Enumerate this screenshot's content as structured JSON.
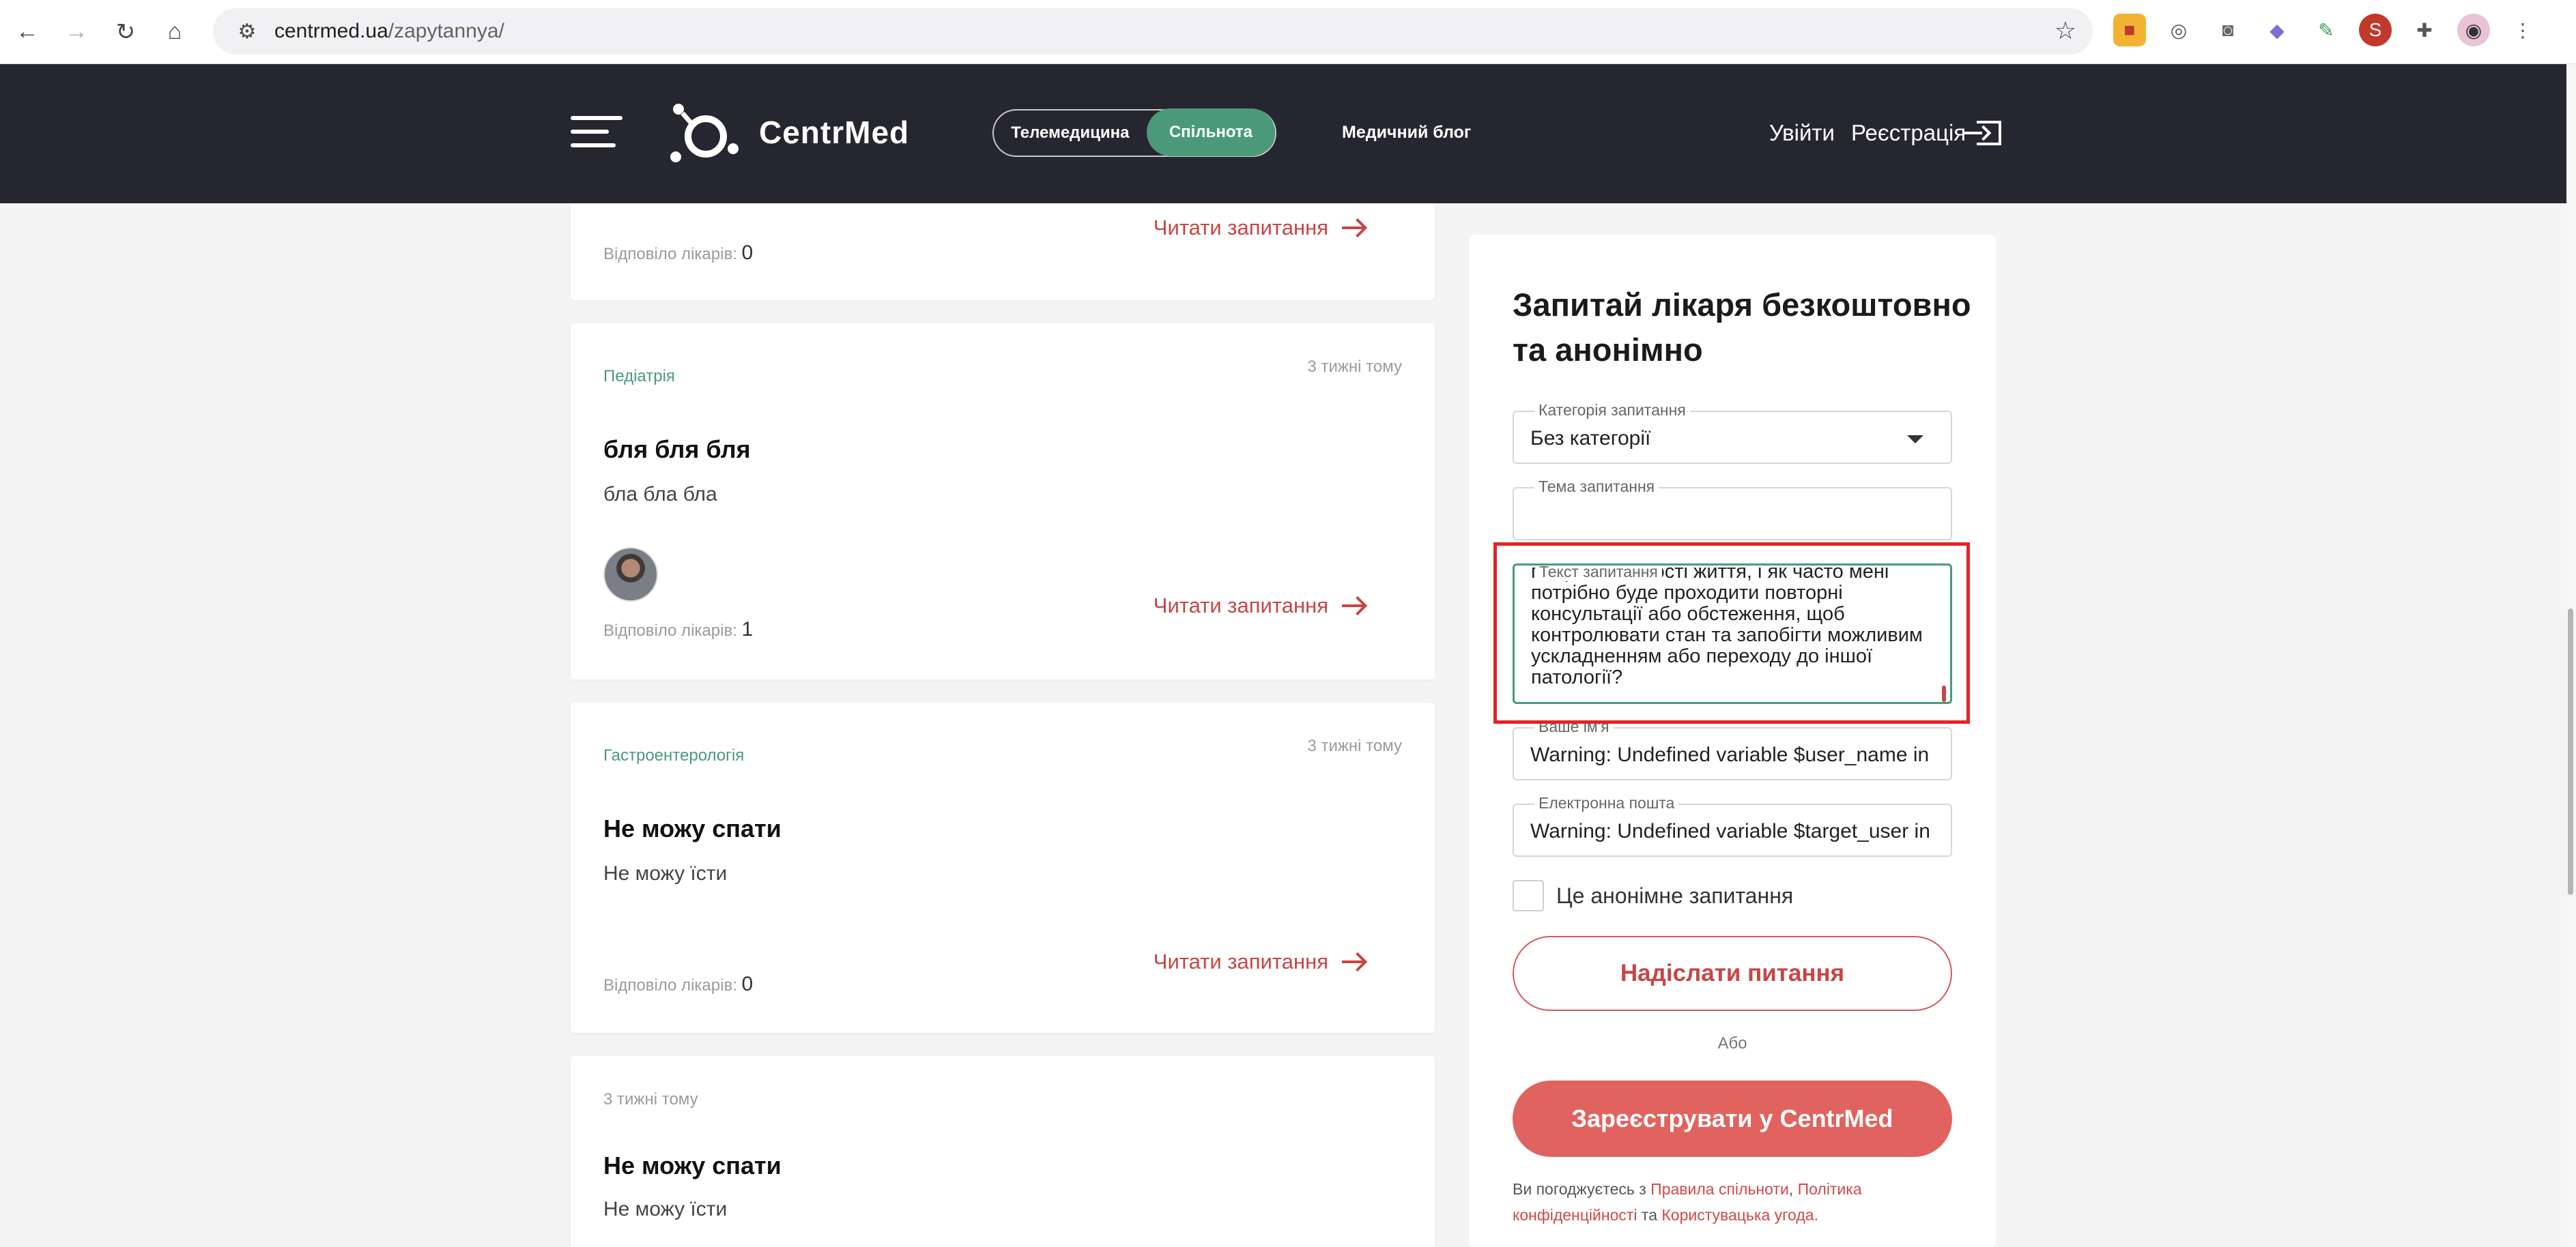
{
  "browser": {
    "url_host": "centrmed.ua",
    "url_path": "/zapytannya/"
  },
  "header": {
    "logo_text": "CentrMed",
    "toggle_telemedicine": "Телемедицина",
    "toggle_community": "Спільнота",
    "blog_link": "Медичний блог",
    "login": "Увійти",
    "register": "Реєстрація"
  },
  "cards": [
    {
      "answered_label": "Відповіло лікарів:",
      "answered_count": "0",
      "read_link": "Читати запитання"
    },
    {
      "category": "Педіатрія",
      "time": "3 тижні тому",
      "title": "бля бля бля",
      "text": "бла бла бла",
      "answered_label": "Відповіло лікарів:",
      "answered_count": "1",
      "read_link": "Читати запитання"
    },
    {
      "category": "Гастроентерологія",
      "time": "3 тижні тому",
      "title": "Не можу спати",
      "text": "Не можу їсти",
      "answered_label": "Відповіло лікарів:",
      "answered_count": "0",
      "read_link": "Читати запитання"
    },
    {
      "time": "3 тижні тому",
      "title": "Не можу спати",
      "text": "Не можу їсти"
    }
  ],
  "form": {
    "title": "Запитай лікаря безкоштовно та анонімно",
    "category_label": "Категорія запитання",
    "category_value": "Без категорії",
    "topic_label": "Тема запитання",
    "topic_value": "",
    "text_label": "Текст запитання",
    "text_value": "погіршенні якості життя, і як часто мені потрібно буде проходити повторні консультації або обстеження, щоб контролювати стан та запобігти можливим ускладненням або переходу до іншої патології?",
    "name_label": "Ваше ім'я",
    "name_value": "Warning: Undefined variable $user_name in",
    "email_label": "Електронна пошта",
    "email_value": "Warning: Undefined variable $target_user in",
    "anon_label": "Це анонімне запитання",
    "submit": "Надіслати питання",
    "or": "Або",
    "register_button": "Зареєструвати у CentrMed",
    "legal_prefix": "Ви погоджуєтесь з ",
    "legal_rules": "Правила спільноти",
    "legal_sep1": ", ",
    "legal_privacy": "Політика конфіденційності",
    "legal_and": " та ",
    "legal_agreement": "Користувацька угода",
    "legal_end": "."
  },
  "colors": {
    "header_bg": "#262631",
    "accent_green": "#4a9a7a",
    "accent_red": "#c84545",
    "button_red": "#e0635f"
  }
}
